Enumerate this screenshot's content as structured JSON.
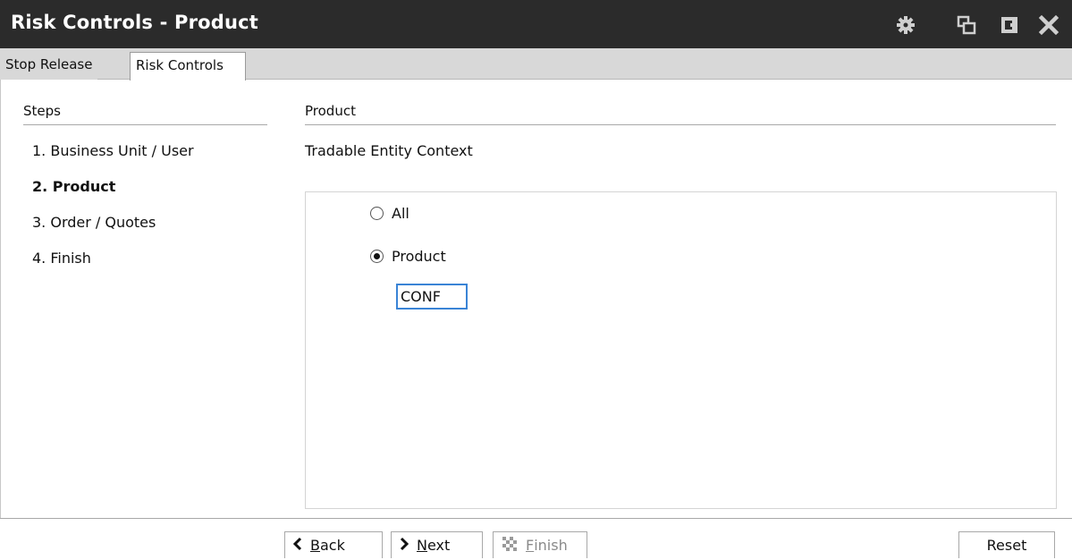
{
  "window": {
    "title": "Risk Controls - Product",
    "controls": [
      "gear-icon",
      "restore-icon",
      "dock-icon",
      "close-icon"
    ]
  },
  "tabs": [
    {
      "label": "Stop Release",
      "active": false
    },
    {
      "label": "Risk Controls",
      "active": true
    }
  ],
  "steps": {
    "header": "Steps",
    "items": [
      {
        "label": "1.  Business Unit / User",
        "active": false
      },
      {
        "label": "2.  Product",
        "active": true
      },
      {
        "label": "3.  Order / Quotes",
        "active": false
      },
      {
        "label": "4.  Finish",
        "active": false
      }
    ]
  },
  "product": {
    "header": "Product",
    "context_label": "Tradable Entity Context",
    "options": [
      {
        "label": "All",
        "selected": false
      },
      {
        "label": "Product",
        "selected": true
      }
    ],
    "product_value": "CONF"
  },
  "footer": {
    "back_mnemonic": "B",
    "back_rest": "ack",
    "next_mnemonic": "N",
    "next_rest": "ext",
    "finish_mnemonic": "F",
    "finish_rest": "inish",
    "finish_disabled": true,
    "reset_label": "Reset"
  },
  "colors": {
    "titlebar_bg": "#2b2b2b",
    "tabstrip_bg": "#d8d8d8",
    "input_focus_border": "#3a84d6"
  }
}
